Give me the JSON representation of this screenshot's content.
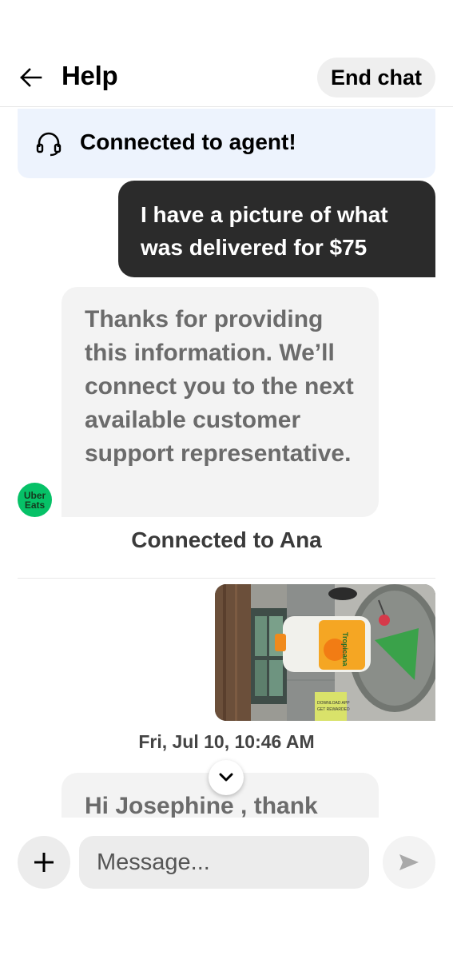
{
  "header": {
    "title": "Help",
    "end_chat_label": "End chat",
    "back_icon": "arrow-left-icon"
  },
  "banner": {
    "icon": "headset-icon",
    "text": "Connected to agent!"
  },
  "messages": [
    {
      "sender": "user",
      "text": "I have a picture of what was delivered for $75"
    },
    {
      "sender": "bot",
      "text": "Thanks for providing this information. We’ll connect you to the next available customer support representative."
    }
  ],
  "avatar": {
    "line1": "Uber",
    "line2": "Eats",
    "color": "#06c167"
  },
  "system_message": "Connected to Ana",
  "photo": {
    "bottle_brand": "Tropicana",
    "sign_text_1": "DOWNLOAD APP",
    "sign_text_2": "GET REWARDED"
  },
  "timestamp": "Fri, Jul 10, 10:46 AM",
  "partial_message": "Hi Josephine , thank",
  "composer": {
    "placeholder": "Message..."
  },
  "colors": {
    "banner_bg": "#edf3fd",
    "user_bubble_bg": "#2b2b2b",
    "bot_bubble_bg": "#f3f3f3",
    "accent_green": "#06c167"
  }
}
